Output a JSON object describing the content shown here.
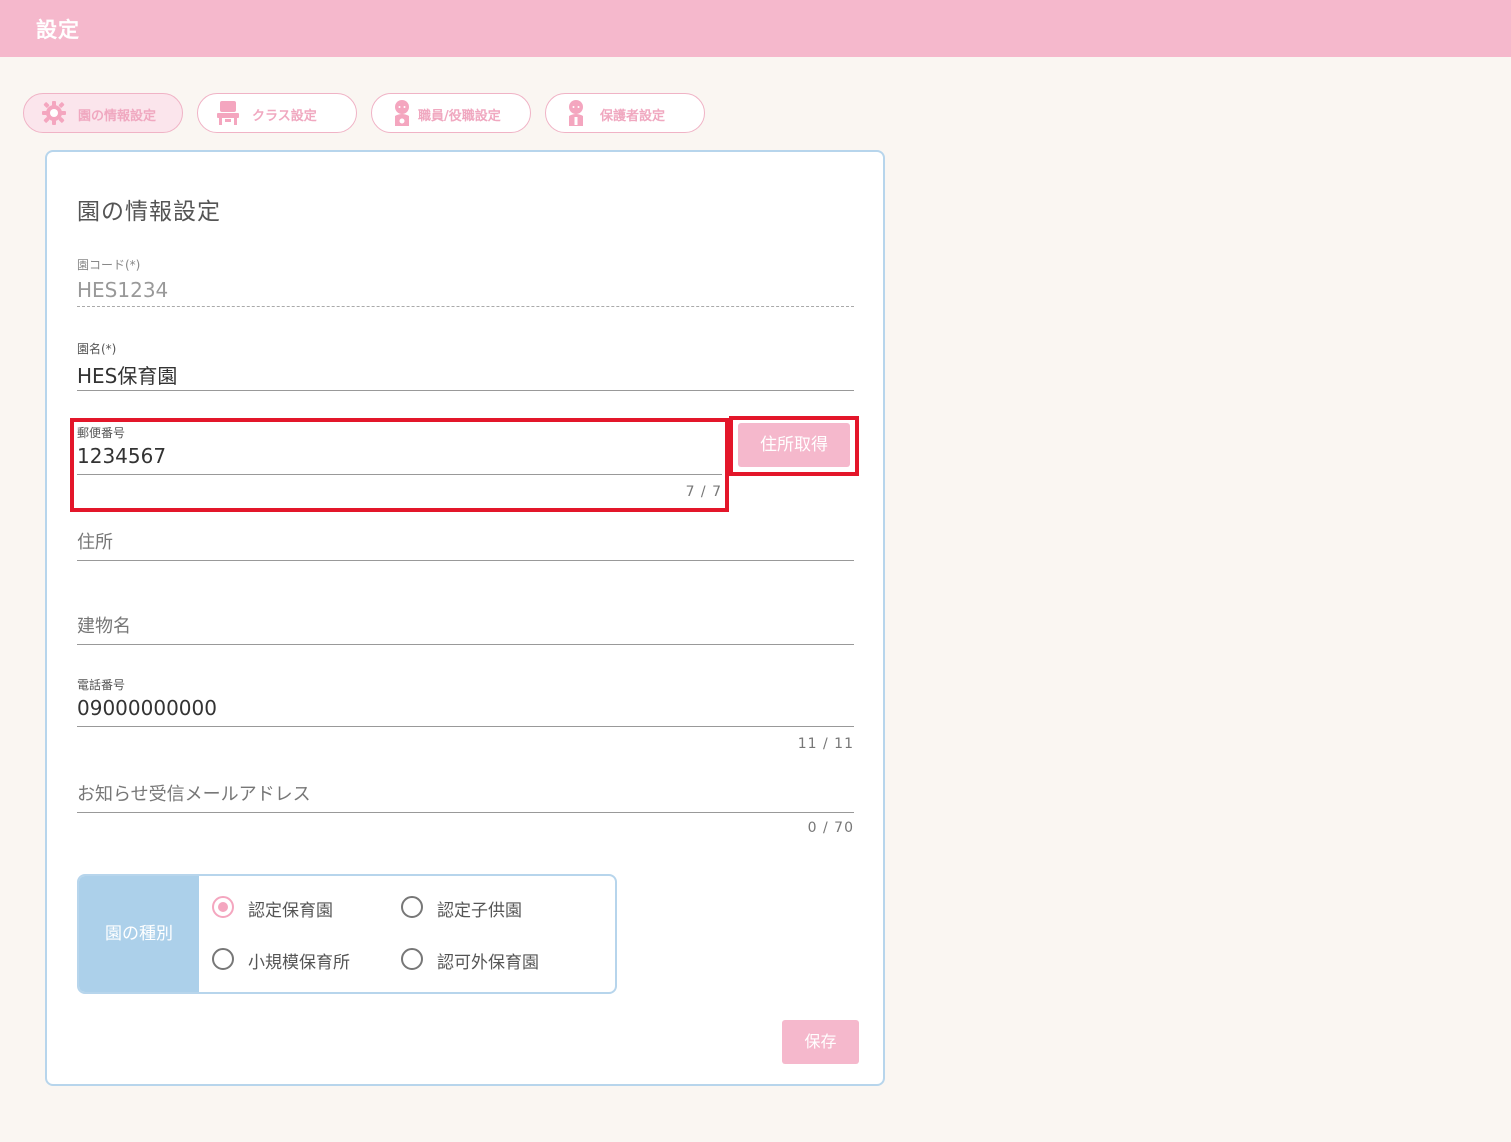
{
  "header": {
    "title": "設定"
  },
  "tabs": [
    {
      "label": "園の情報設定",
      "icon": "gear-icon",
      "active": true
    },
    {
      "label": "クラス設定",
      "icon": "class-icon",
      "active": false
    },
    {
      "label": "職員/役職設定",
      "icon": "staff-icon",
      "active": false
    },
    {
      "label": "保護者設定",
      "icon": "guardian-icon",
      "active": false
    }
  ],
  "form": {
    "title": "園の情報設定",
    "school_code": {
      "label": "園コード(*)",
      "value": "HES1234"
    },
    "school_name": {
      "label": "園名(*)",
      "value": "HES保育園"
    },
    "postal_code": {
      "label": "郵便番号",
      "value": "1234567",
      "counter": "7 / 7"
    },
    "address_button": "住所取得",
    "address": {
      "placeholder": "住所"
    },
    "building": {
      "placeholder": "建物名"
    },
    "phone": {
      "label": "電話番号",
      "value": "09000000000",
      "counter": "11 / 11"
    },
    "email": {
      "placeholder": "お知らせ受信メールアドレス",
      "counter": "0 / 70"
    },
    "school_type": {
      "label": "園の種別",
      "options": [
        {
          "label": "認定保育園",
          "checked": true
        },
        {
          "label": "認定子供園",
          "checked": false
        },
        {
          "label": "小規模保育所",
          "checked": false
        },
        {
          "label": "認可外保育園",
          "checked": false
        }
      ]
    },
    "save_button": "保存"
  },
  "colors": {
    "header_bg": "#f5b8cc",
    "accent_pink": "#f4a6bf",
    "border_blue": "#b7d5ec",
    "type_label_bg": "#acd0ea",
    "highlight_red": "#e3162a"
  }
}
